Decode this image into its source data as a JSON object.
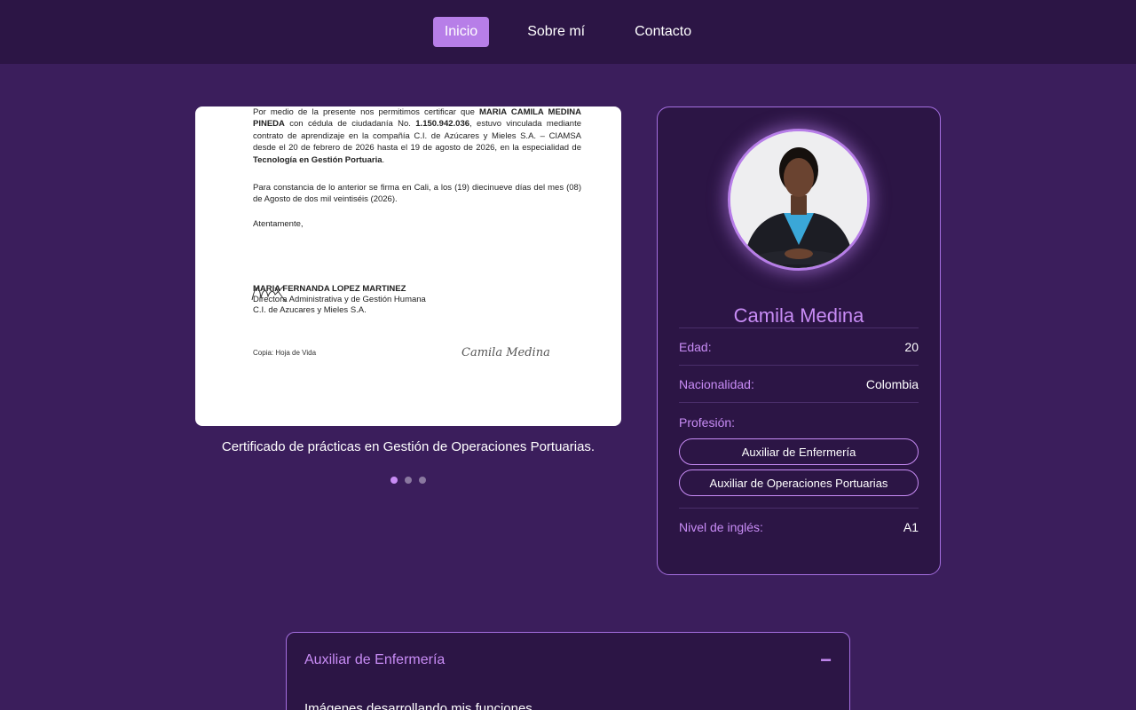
{
  "nav": {
    "items": [
      {
        "label": "Inicio",
        "active": true
      },
      {
        "label": "Sobre mí",
        "active": false
      },
      {
        "label": "Contacto",
        "active": false
      }
    ]
  },
  "carousel": {
    "document": {
      "p1_a": "Por medio de la presente nos permitimos certificar que ",
      "p1_name": "MARIA CAMILA MEDINA PINEDA",
      "p1_b": " con cédula de ciudadanía No. ",
      "p1_id": "1.150.942.036",
      "p1_c": ", estuvo vinculada mediante contrato de aprendizaje en la compañía C.I. de Azúcares y Mieles S.A. – CIAMSA desde el 20 de febrero de 2026 hasta el 19 de agosto de 2026, en la especialidad de ",
      "p1_spec": "Tecnología en Gestión Portuaria",
      "p1_d": ".",
      "p2": "Para constancia de lo anterior se firma en Cali, a los (19) diecinueve días del mes (08) de Agosto de dos mil veintiséis (2026).",
      "closing": "Atentamente,",
      "signer_name": "MARIA FERNANDA LOPEZ MARTINEZ",
      "signer_role": "Directora Administrativa y de Gestión Humana",
      "signer_company": "C.I. de Azucares y Mieles S.A.",
      "copia": "Copia: Hoja de Vida",
      "handwritten": "Camila Medina"
    },
    "caption": "Certificado de prácticas en Gestión de Operaciones Portuarias.",
    "dots": [
      true,
      false,
      false
    ]
  },
  "profile": {
    "name": "Camila Medina",
    "age_label": "Edad:",
    "age_value": "20",
    "nationality_label": "Nacionalidad:",
    "nationality_value": "Colombia",
    "profession_label": "Profesión:",
    "professions": [
      "Auxiliar de Enfermería",
      "Auxiliar de Operaciones Portuarias"
    ],
    "english_label": "Nivel de inglés:",
    "english_value": "A1"
  },
  "accordion": {
    "title": "Auxiliar de Enfermería",
    "toggle": "−",
    "body": "Imágenes desarrollando mis funciones"
  },
  "colors": {
    "background": "#3b1e5c",
    "nav_bg": "#2c1545",
    "accent": "#b77ee8",
    "accent_text": "#c88cf5"
  }
}
